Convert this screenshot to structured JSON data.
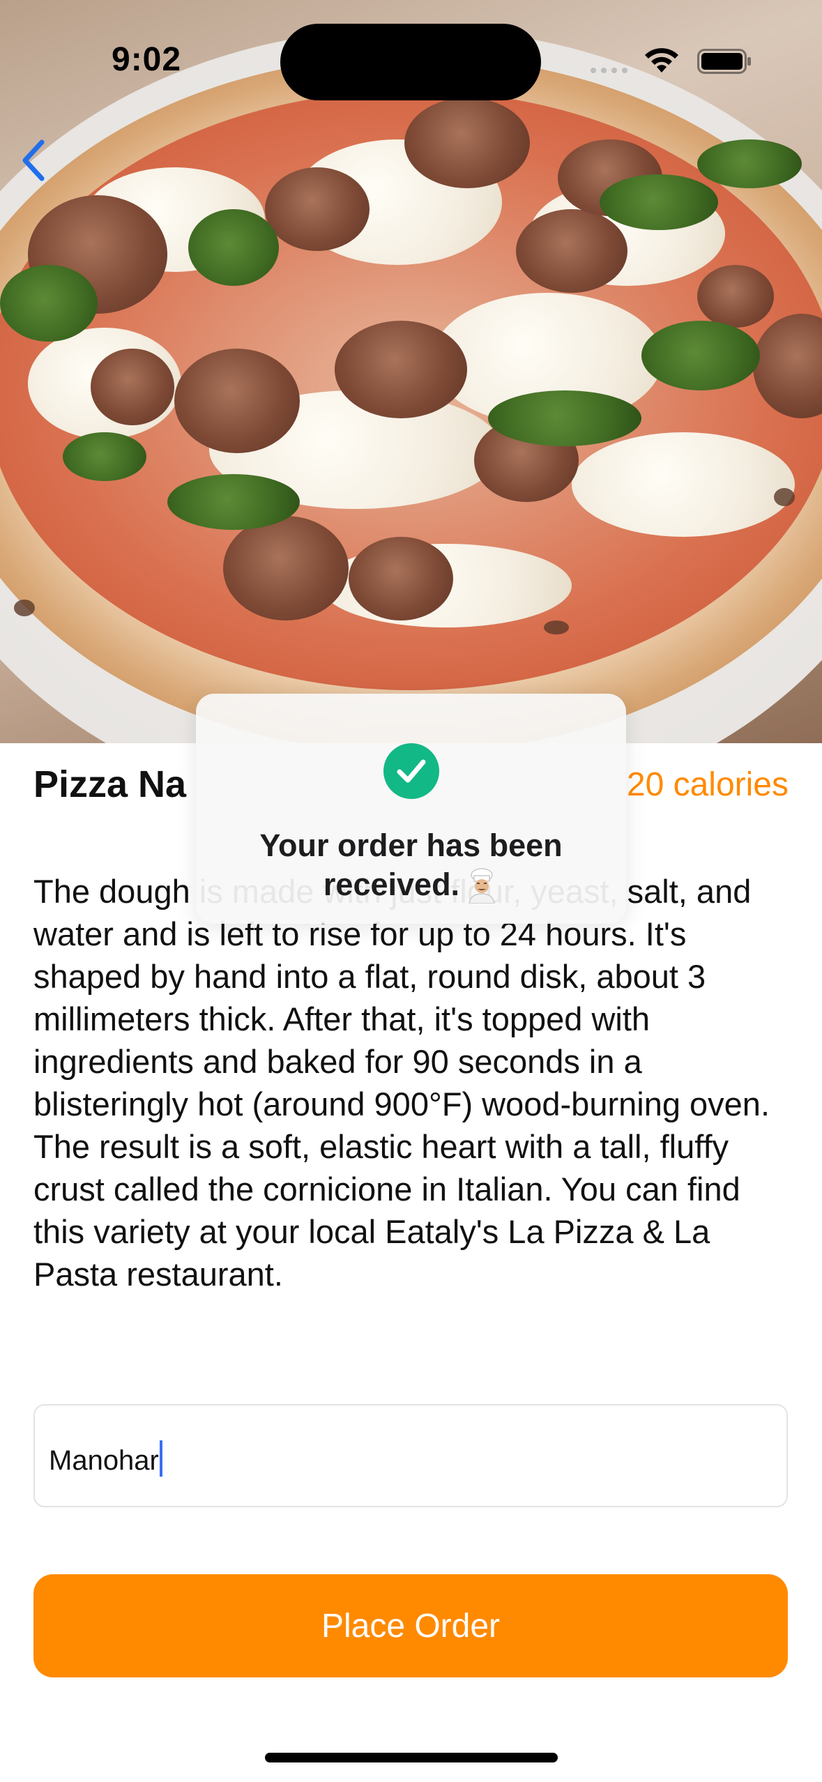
{
  "status_bar": {
    "time": "9:02"
  },
  "navigation": {
    "back_icon": "chevron-left-icon",
    "accent_color": "#1f6feb"
  },
  "hero_image": {
    "subject": "pizza photo"
  },
  "item": {
    "title": "Pizza Na",
    "calories": "20 calories",
    "description": "The dough is made with just flour, yeast, salt, and water and is left to rise for up to 24 hours. It's shaped by hand into a flat, round disk, about 3 millimeters thick. After that, it's topped with ingredients and baked for 90 seconds in a blisteringly hot (around 900°F) wood-burning oven. The result is a soft, elastic heart with a tall, fluffy crust called the cornicione in Italian. You can find this variety at your local Eataly's La Pizza & La Pasta restaurant."
  },
  "order_form": {
    "name_value": "Manohar",
    "place_order_label": "Place Order",
    "button_color": "#ff8a00"
  },
  "toast": {
    "icon": "checkmark-circle-icon",
    "icon_color": "#12b886",
    "message": "Your order has been received.",
    "emoji_icon": "chef-emoji-icon"
  }
}
